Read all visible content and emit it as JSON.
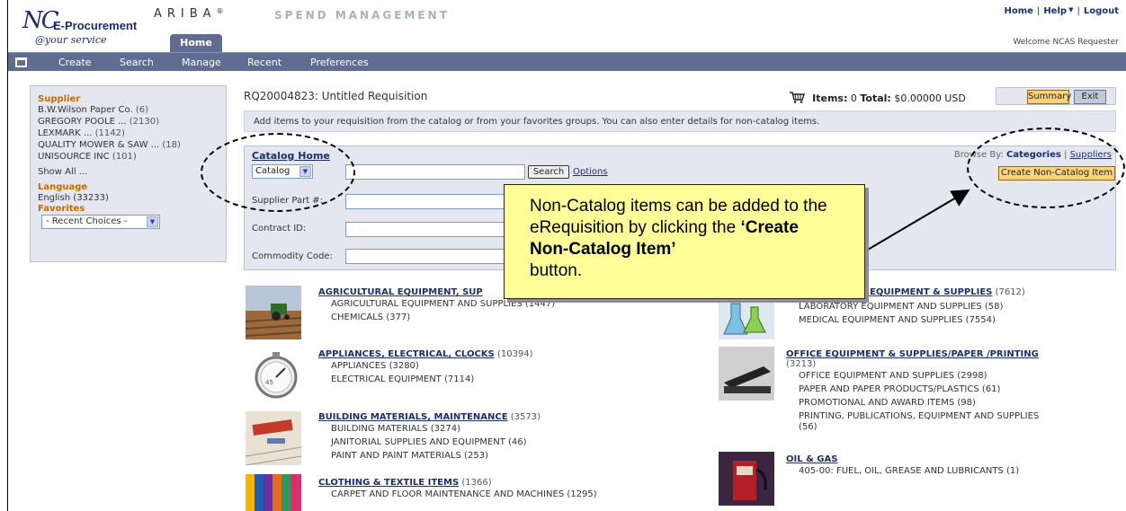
{
  "header": {
    "logo_nc": "NC",
    "logo_eprocurement": "E-Procurement",
    "logo_tagline": "@your service",
    "ariba": "ARIBA",
    "ariba_reg": "®",
    "spend": "SPEND MANAGEMENT",
    "home_link": "Home",
    "help_link": "Help",
    "logout_link": "Logout",
    "welcome": "Welcome NCAS Requester",
    "home_tab": "Home"
  },
  "menu": {
    "create": "Create",
    "search": "Search",
    "manage": "Manage",
    "recent": "Recent",
    "preferences": "Preferences"
  },
  "sidebar": {
    "supplier_heading": "Supplier",
    "suppliers": [
      {
        "name": "B.W.Wilson Paper Co.",
        "count": "(6)"
      },
      {
        "name": "GREGORY POOLE ...",
        "count": "(2130)"
      },
      {
        "name": "LEXMARK ...",
        "count": "(1142)"
      },
      {
        "name": "QUALITY MOWER & SAW ...",
        "count": "(18)"
      },
      {
        "name": "UNISOURCE INC",
        "count": "(101)"
      }
    ],
    "show_all": "Show All ...",
    "language_heading": "Language",
    "language_value": "English (33233)",
    "favorites_heading": "Favorites",
    "favorites_select": "- Recent Choices -"
  },
  "requisition": {
    "title": "RQ20004823: Untitled Requisition",
    "items_label": "Items:",
    "items_value": "0",
    "total_label": "Total:",
    "total_value": "$0.00000 USD",
    "summary_button": "Summary",
    "exit_button": "Exit",
    "info": "Add items to your requisition from the catalog or from your favorites groups. You can also enter details for non-catalog items."
  },
  "catalog": {
    "home_link": "Catalog Home",
    "scope_select": "Catalog",
    "search_value": "",
    "search_button": "Search",
    "options_link": "Options",
    "supplier_part_label": "Supplier Part #:",
    "contract_label": "Contract ID:",
    "commodity_label": "Commodity Code:",
    "browse_by_label": "Browse By:",
    "categories_link": "Categories",
    "suppliers_link": "Suppliers",
    "non_catalog_button": "Create Non-Catalog Item"
  },
  "categories_left": [
    {
      "title": "AGRICULTURAL EQUIPMENT, SUP",
      "count": "",
      "subs": [
        "AGRICULTURAL EQUIPMENT AND SUPPLIES (1447)",
        "CHEMICALS (377)"
      ]
    },
    {
      "title": "APPLIANCES, ELECTRICAL, CLOCKS",
      "count": "(10394)",
      "subs": [
        "APPLIANCES (3280)",
        "ELECTRICAL EQUIPMENT (7114)"
      ]
    },
    {
      "title": "BUILDING MATERIALS, MAINTENANCE",
      "count": "(3573)",
      "subs": [
        "BUILDING MATERIALS (3274)",
        "JANITORIAL SUPPLIES AND EQUIPMENT (46)",
        "PAINT AND PAINT MATERIALS (253)"
      ]
    },
    {
      "title": "CLOTHING & TEXTILE ITEMS",
      "count": "(1366)",
      "subs": [
        "CARPET AND FLOOR MAINTENANCE AND MACHINES (1295)"
      ]
    }
  ],
  "categories_right": [
    {
      "title": "B EQUIPMENT & SUPPLIES",
      "count": "(7612)",
      "subs": [
        "LABORATORY EQUIPMENT AND SUPPLIES (58)",
        "MEDICAL EQUIPMENT AND SUPPLIES (7554)"
      ]
    },
    {
      "title": "OFFICE EQUIPMENT & SUPPLIES/PAPER /PRINTING",
      "count": "(3213)",
      "subs": [
        "OFFICE EQUIPMENT AND SUPPLIES (2998)",
        "PAPER AND PAPER PRODUCTS/PLASTICS (61)",
        "PROMOTIONAL AND AWARD ITEMS (98)",
        "PRINTING, PUBLICATIONS, EQUIPMENT AND SUPPLIES (56)"
      ]
    },
    {
      "title": "OIL & GAS",
      "count": "",
      "subs": [
        "405-00: FUEL, OIL, GREASE AND LUBRICANTS (1)"
      ]
    }
  ],
  "callout": {
    "line1": "Non-Catalog items can be added to the eRequisition by clicking the",
    "bold": "‘Create Non-Catalog Item’",
    "line2": "button."
  },
  "colors": {
    "menubar": "#5f6d92",
    "panel": "#e4e7ef",
    "link": "#1b2f6e",
    "button_yellow": "#ffd37a",
    "callout": "#ffff99",
    "heading_orange": "#c76a00"
  },
  "icons": {
    "cart": "shopping-cart-icon",
    "help_dropdown": "chevron-down-icon",
    "menu_toggle": "menu-window-icon"
  }
}
